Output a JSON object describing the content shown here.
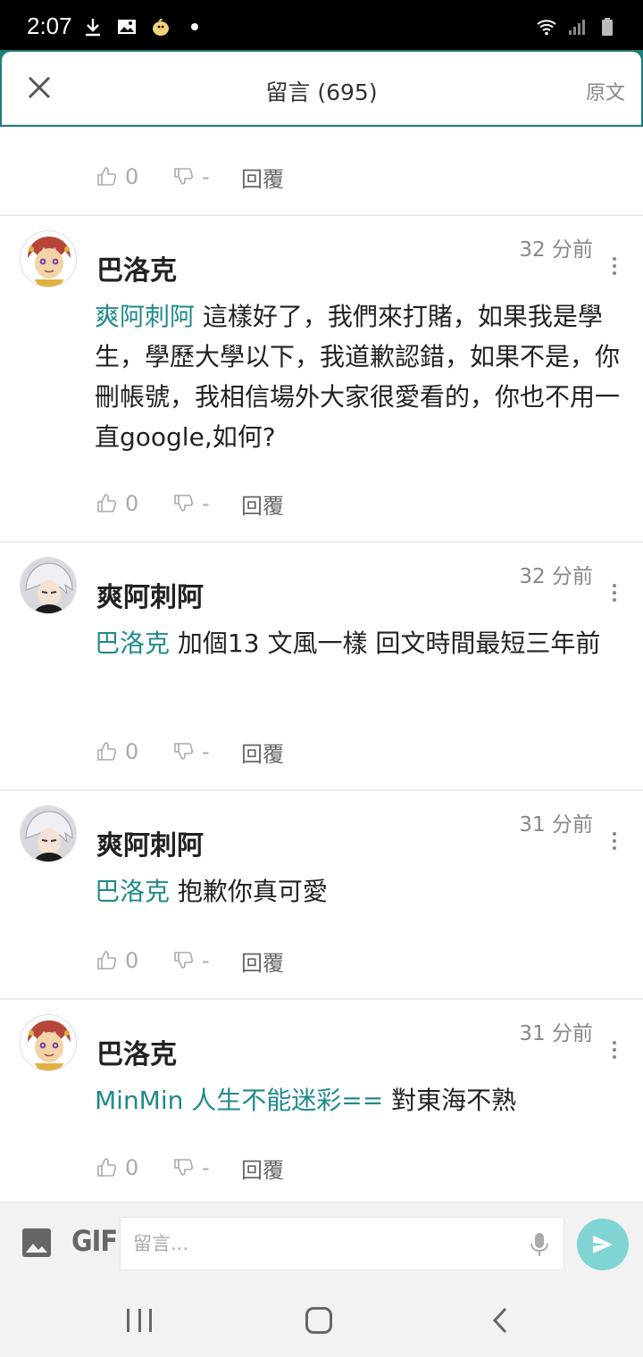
{
  "status_bar": {
    "time": "2:07",
    "left_icons": [
      "download-icon",
      "image-icon",
      "chick-icon",
      "dot"
    ],
    "right_icons": [
      "wifi-icon",
      "signal-icon",
      "battery-icon"
    ]
  },
  "header": {
    "title": "留言 (695)",
    "original_label": "原文",
    "accent_color": "#1f7f7d"
  },
  "top_actions": {
    "like_count": "0",
    "dislike_count": "-",
    "reply_label": "回覆"
  },
  "comments": [
    {
      "author": "巴洛克",
      "avatar": "jester-avatar",
      "time": "32 分前",
      "mention": "爽阿刺阿",
      "text": " 這樣好了，我們來打賭，如果我是學生，學歷大學以下，我道歉認錯，如果不是，你刪帳號，我相信場外大家很愛看的，你也不用一直google,如何?",
      "like_count": "0",
      "dislike_count": "-",
      "reply_label": "回覆"
    },
    {
      "author": "爽阿刺阿",
      "avatar": "silver-hair-avatar",
      "time": "32 分前",
      "mention": "巴洛克",
      "text": " 加個13 文風一樣 回文時間最短三年前",
      "like_count": "0",
      "dislike_count": "-",
      "reply_label": "回覆"
    },
    {
      "author": "爽阿刺阿",
      "avatar": "silver-hair-avatar",
      "time": "31 分前",
      "mention": "巴洛克",
      "text": " 抱歉你真可愛",
      "like_count": "0",
      "dislike_count": "-",
      "reply_label": "回覆"
    },
    {
      "author": "巴洛克",
      "avatar": "jester-avatar",
      "time": "31 分前",
      "mention": "MinMin 人生不能迷彩==",
      "text": " 對東海不熟",
      "like_count": "0",
      "dislike_count": "-",
      "reply_label": "回覆"
    }
  ],
  "input_bar": {
    "gif_label": "GIF",
    "placeholder": "留言...",
    "send_color": "#80d4d4"
  }
}
